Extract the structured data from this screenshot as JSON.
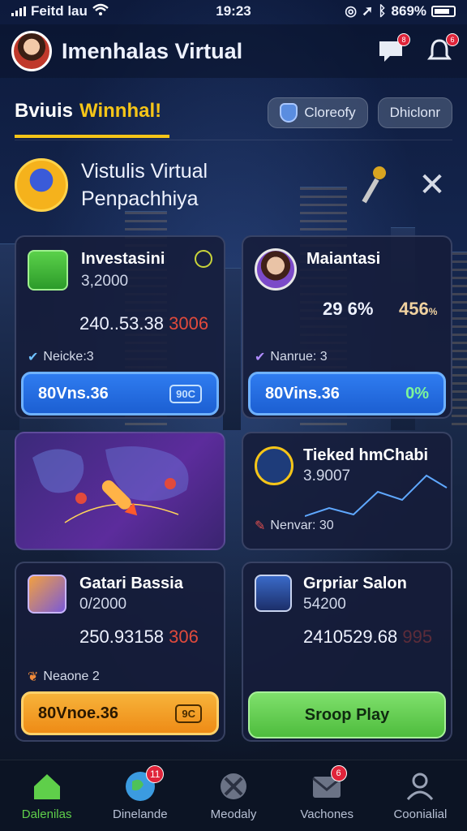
{
  "status_bar": {
    "carrier": "Feitd lau",
    "time": "19:23",
    "battery": "869%"
  },
  "header": {
    "title": "Imenhalas Virtual",
    "message_badge": "8",
    "notification_badge": "6"
  },
  "tabs": {
    "brand_part1": "Bviuis",
    "brand_part2": "Winnhal!",
    "tab1": "Cloreofy",
    "tab2": "Dhiclonr"
  },
  "promo": {
    "line1": "Vistulis Virtual",
    "line2": "Penpachhiya"
  },
  "cards": {
    "investasi": {
      "title": "Investasini",
      "sub": "3,2000",
      "value": "240..53.38",
      "value_red": "3006",
      "tag": "Neicke:3",
      "button": "80Vns.36",
      "chip": "90C"
    },
    "maiantasi": {
      "title": "Maiantasi",
      "stat1": "29 6%",
      "stat2": "456",
      "stat2_unit": "%",
      "tag": "Nanrue: 3",
      "button": "80Vins.36",
      "button_right": "0%"
    },
    "ticket": {
      "title": "Tieked hmChabi",
      "sub": "3.9007",
      "tag": "Nenvar: 30"
    },
    "gatari": {
      "title": "Gatari Bassia",
      "sub": "0/2000",
      "value": "250.93158",
      "value_red": "306",
      "tag": "Neaone 2",
      "button": "80Vnoe.36",
      "chip": "9C"
    },
    "gratar": {
      "title": "Grpriar Salon",
      "sub": "54200",
      "value": "2410529.68",
      "value_red": "995",
      "button": "Sroop Play"
    }
  },
  "bottom_nav": [
    {
      "label": "Dalenilas",
      "badge": ""
    },
    {
      "label": "Dinelande",
      "badge": "11"
    },
    {
      "label": "Meodaly",
      "badge": ""
    },
    {
      "label": "Vachones",
      "badge": "6"
    },
    {
      "label": "Coonialial",
      "badge": ""
    }
  ],
  "colors": {
    "accent_yellow": "#f5c518",
    "button_blue": "#2f7cf0",
    "button_orange": "#f7b33a",
    "button_green": "#7fe06c",
    "nav_active": "#5fcf4a",
    "badge_red": "#e0243a"
  }
}
